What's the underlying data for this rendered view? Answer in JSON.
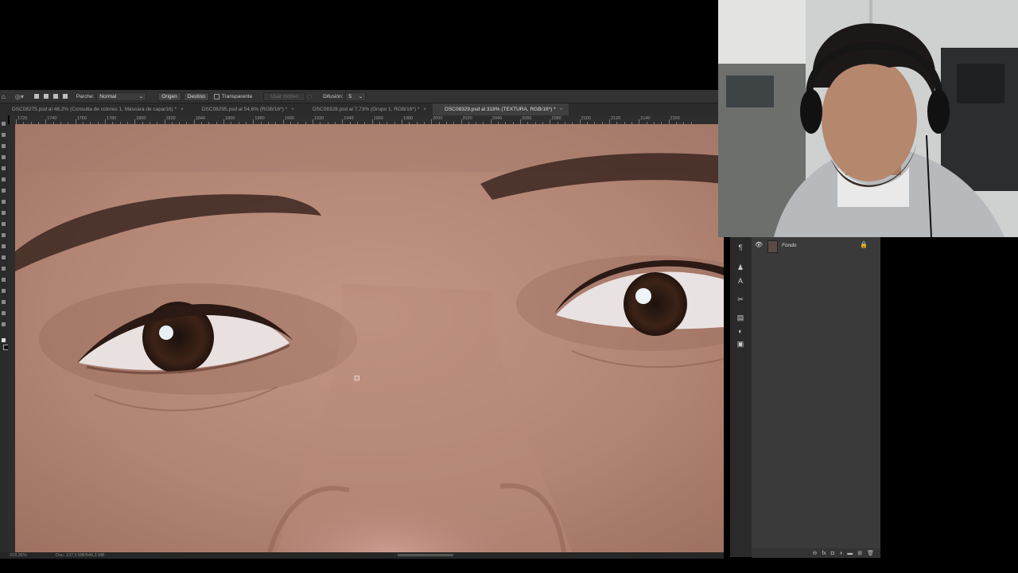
{
  "options_bar": {
    "patch_label": "Parche:",
    "patch_mode": "Normal",
    "source_button": "Origen",
    "destination_button": "Destino",
    "transparent_label": "Transparente",
    "use_pattern_label": "Usar motivo",
    "diffusion_label": "Difusión:",
    "diffusion_value": "5"
  },
  "tabs": [
    {
      "label": "DSC08275.psd al 48,2% (Consulta de colores 1, Máscara de capa/16) *",
      "close": "×"
    },
    {
      "label": "DSC08295.psd al 54,6% (RGB/16*) *",
      "close": "×"
    },
    {
      "label": "DSC08328.psd al 7,73% (Grupo 1, RGB/16*) *",
      "close": "×"
    },
    {
      "label": "DSC08329.psd al 318% (TEXTURA, RGB/16*) *",
      "close": "×"
    }
  ],
  "ruler_labels": [
    "1720",
    "1740",
    "1760",
    "1780",
    "1800",
    "1820",
    "1840",
    "1860",
    "1880",
    "1900",
    "1920",
    "1940",
    "1960",
    "1980",
    "2000",
    "2020",
    "2040",
    "2060",
    "2080",
    "2100",
    "2120",
    "2140",
    "2160"
  ],
  "status_bar": {
    "zoom": "318,36%",
    "doc": "Doc: 137,3 MB/549,3 MB"
  },
  "layers_panel": {
    "layer_name": "Fondo"
  },
  "colors": {
    "panel_bg": "#3a3a3a",
    "app_bg": "#2b2b2b",
    "skin": "#b98878"
  }
}
